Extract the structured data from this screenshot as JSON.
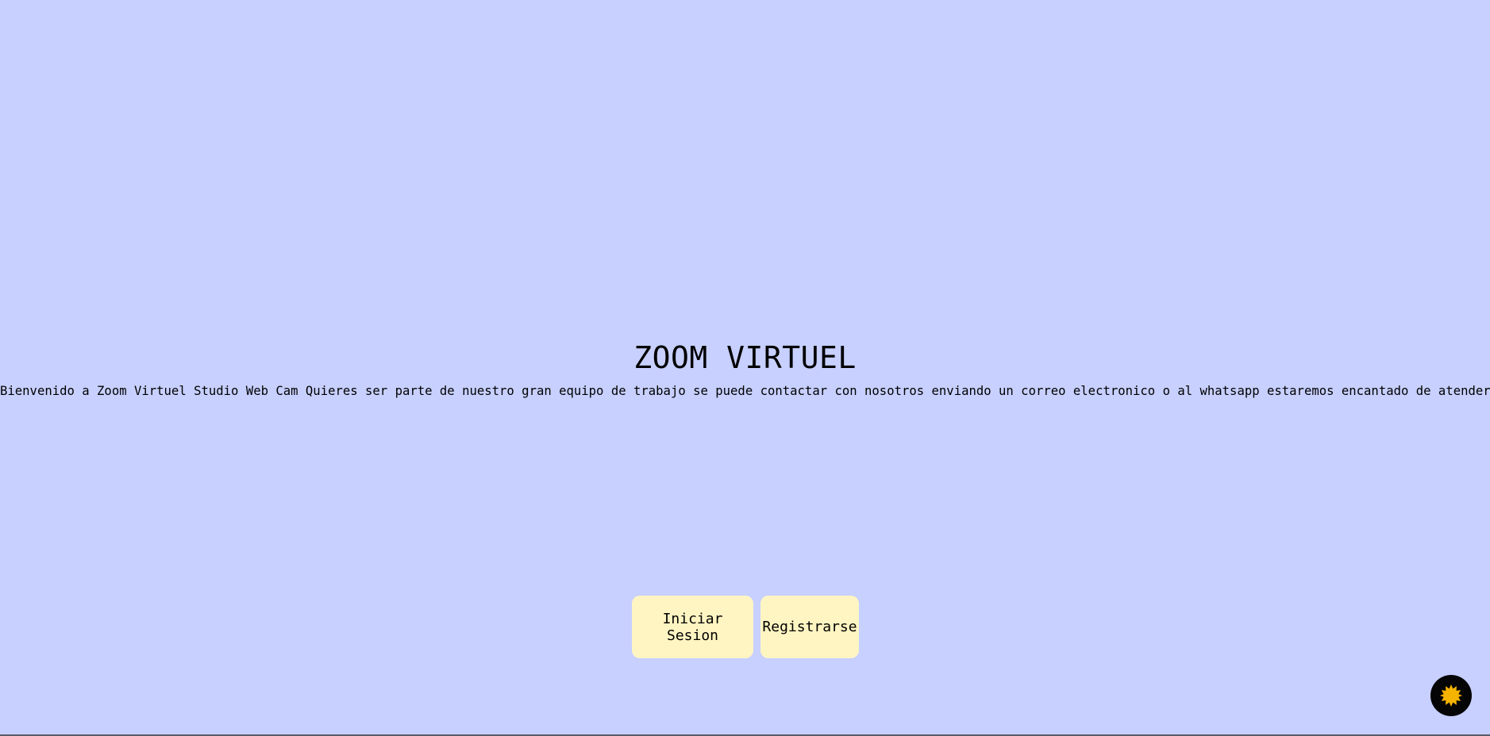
{
  "hero": {
    "title": "ZOOM VIRTUEL",
    "intro": "Bienvenido a Zoom Virtuel Studio Web Cam Quieres ser parte de nuestro gran equipo de trabajo se puede contactar con nosotros enviando un correo electronico o al whatsapp estaremos encantado de atenderle"
  },
  "actions": {
    "login_label": "Iniciar Sesion",
    "register_label": "Registrarse"
  },
  "theme_toggle": {
    "icon": "sun-icon"
  },
  "colors": {
    "background": "#c7d0ff",
    "button_bg": "#fff5c2",
    "toggle_bg": "#050505",
    "sun": "#f5b400"
  }
}
